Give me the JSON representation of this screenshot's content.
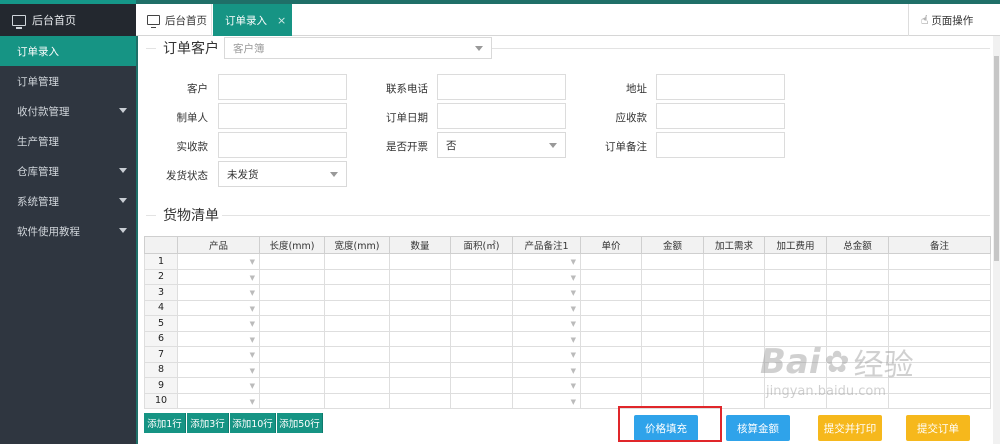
{
  "sidebar": {
    "home_label": "后台首页",
    "items": [
      {
        "label": "订单录入",
        "active": true,
        "has_children": false
      },
      {
        "label": "订单管理",
        "active": false,
        "has_children": false
      },
      {
        "label": "收付款管理",
        "active": false,
        "has_children": true
      },
      {
        "label": "生产管理",
        "active": false,
        "has_children": false
      },
      {
        "label": "仓库管理",
        "active": false,
        "has_children": true
      },
      {
        "label": "系统管理",
        "active": false,
        "has_children": true
      },
      {
        "label": "软件使用教程",
        "active": false,
        "has_children": true
      }
    ]
  },
  "tabs": {
    "home": "后台首页",
    "order_entry": "订单录入",
    "close_glyph": "×",
    "page_ops": "页面操作"
  },
  "customer_section": {
    "title": "订单客户",
    "select_placeholder": "客户簿"
  },
  "form": {
    "customer": "客户",
    "phone": "联系电话",
    "address": "地址",
    "creator": "制单人",
    "order_date": "订单日期",
    "receivable": "应收款",
    "received": "实收款",
    "invoiced": "是否开票",
    "invoiced_value": "否",
    "order_note": "订单备注",
    "ship_status": "发货状态",
    "ship_status_value": "未发货"
  },
  "goods_section": {
    "title": "货物清单"
  },
  "table": {
    "headers": [
      "",
      "产品",
      "长度(mm)",
      "宽度(mm)",
      "数量",
      "面积(㎡)",
      "产品备注1",
      "单价",
      "金额",
      "加工需求",
      "加工费用",
      "总金额",
      "备注"
    ],
    "rows": [
      "1",
      "2",
      "3",
      "4",
      "5",
      "6",
      "7",
      "8",
      "9",
      "10"
    ],
    "dropdown_glyph": "▼"
  },
  "buttons": {
    "add1": "添加1行",
    "add3": "添加3行",
    "add10": "添加10行",
    "add50": "添加50行",
    "price_fill": "价格填充",
    "check_amount": "核算金额",
    "submit_print": "提交并打印",
    "submit_order": "提交订单"
  },
  "colors": {
    "sidebar_bg": "#2f3640",
    "accent": "#169484",
    "blue_button": "#2fa3ea",
    "orange_button": "#f6b81c",
    "highlight_box": "#e0262a"
  },
  "watermark": {
    "line1": "Bai",
    "line2": "经验",
    "line3": "jingyan.baidu.com"
  }
}
